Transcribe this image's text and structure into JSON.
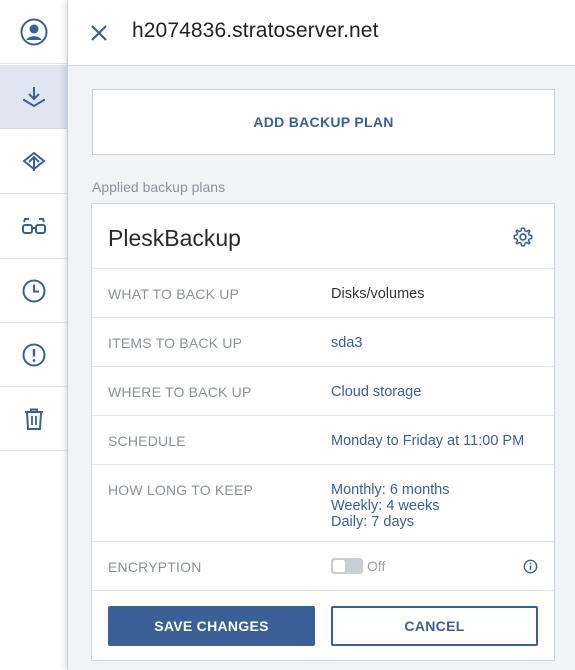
{
  "rail": {
    "items": [
      {
        "icon": "user-icon"
      },
      {
        "icon": "download-icon"
      },
      {
        "icon": "recovery-icon"
      },
      {
        "icon": "glasses-icon"
      },
      {
        "icon": "clock-icon"
      },
      {
        "icon": "alert-icon"
      },
      {
        "icon": "trash-icon"
      }
    ]
  },
  "header": {
    "title": "h2074836.stratoserver.net"
  },
  "actions": {
    "add_backup_plan": "ADD BACKUP PLAN"
  },
  "applied_label": "Applied backup plans",
  "plan": {
    "name": "PleskBackup",
    "rows": [
      {
        "key": "WHAT TO BACK UP",
        "value": "Disks/volumes"
      },
      {
        "key": "ITEMS TO BACK UP",
        "value": "sda3"
      },
      {
        "key": "WHERE TO BACK UP",
        "value": "Cloud storage"
      },
      {
        "key": "SCHEDULE",
        "value": "Monday to Friday at 11:00 PM"
      },
      {
        "key": "HOW LONG TO KEEP",
        "value_lines": [
          "Monthly: 6 months",
          "Weekly: 4 weeks",
          "Daily: 7 days"
        ]
      }
    ],
    "encryption": {
      "key": "ENCRYPTION",
      "state": "Off"
    }
  },
  "buttons": {
    "save": "SAVE CHANGES",
    "cancel": "CANCEL"
  },
  "colors": {
    "accent": "#3b5f97",
    "muted": "#8a929c",
    "panel_bg": "#f2f3f5"
  }
}
